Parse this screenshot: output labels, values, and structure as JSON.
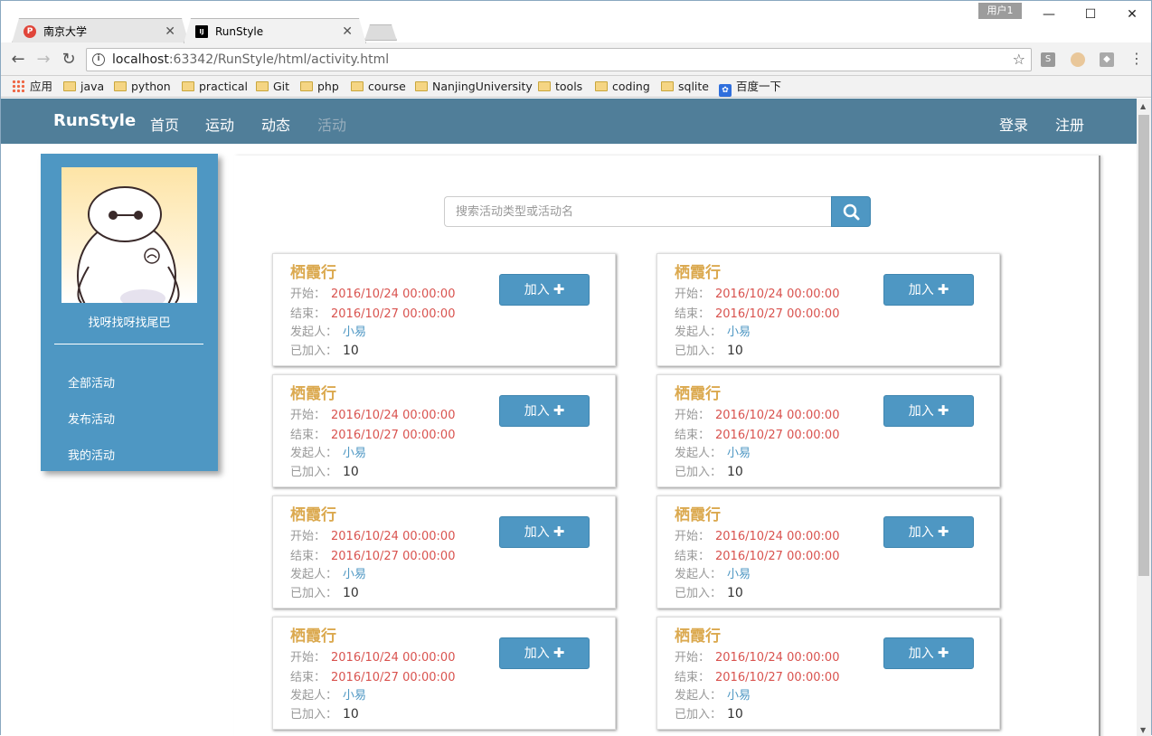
{
  "browser": {
    "tabs": [
      {
        "label": "南京大学",
        "favicon": "P"
      },
      {
        "label": "RunStyle",
        "favicon": "IJ"
      }
    ],
    "user_badge": "用户1",
    "address_host": "localhost",
    "address_rest": ":63342/RunStyle/html/activity.html",
    "bookmarks": [
      "应用",
      "java",
      "python",
      "practical",
      "Git",
      "php",
      "course",
      "NanjingUniversity",
      "tools",
      "coding",
      "sqlite",
      "百度一下"
    ]
  },
  "site": {
    "brand": "RunStyle",
    "nav": [
      "首页",
      "运动",
      "动态",
      "活动"
    ],
    "nav_active": "活动",
    "auth": [
      "登录",
      "注册"
    ]
  },
  "sidebar": {
    "username": "找呀找呀找尾巴",
    "links": [
      "全部活动",
      "发布活动",
      "我的活动"
    ]
  },
  "search": {
    "placeholder": "搜索活动类型或活动名"
  },
  "labels": {
    "start": "开始：",
    "end": "结束：",
    "organizer": "发起人：",
    "joined": "已加入：",
    "join_button": "加入"
  },
  "activities": [
    {
      "title": "栖霞行",
      "start": "2016/10/24 00:00:00",
      "end": "2016/10/27 00:00:00",
      "organizer": "小易",
      "joined": "10"
    },
    {
      "title": "栖霞行",
      "start": "2016/10/24 00:00:00",
      "end": "2016/10/27 00:00:00",
      "organizer": "小易",
      "joined": "10"
    },
    {
      "title": "栖霞行",
      "start": "2016/10/24 00:00:00",
      "end": "2016/10/27 00:00:00",
      "organizer": "小易",
      "joined": "10"
    },
    {
      "title": "栖霞行",
      "start": "2016/10/24 00:00:00",
      "end": "2016/10/27 00:00:00",
      "organizer": "小易",
      "joined": "10"
    },
    {
      "title": "栖霞行",
      "start": "2016/10/24 00:00:00",
      "end": "2016/10/27 00:00:00",
      "organizer": "小易",
      "joined": "10"
    },
    {
      "title": "栖霞行",
      "start": "2016/10/24 00:00:00",
      "end": "2016/10/27 00:00:00",
      "organizer": "小易",
      "joined": "10"
    },
    {
      "title": "栖霞行",
      "start": "2016/10/24 00:00:00",
      "end": "2016/10/27 00:00:00",
      "organizer": "小易",
      "joined": "10"
    },
    {
      "title": "栖霞行",
      "start": "2016/10/24 00:00:00",
      "end": "2016/10/27 00:00:00",
      "organizer": "小易",
      "joined": "10"
    }
  ],
  "colors": {
    "navbar": "#507e99",
    "accent": "#4e97c3",
    "title": "#dba94f",
    "date": "#d9534f"
  }
}
